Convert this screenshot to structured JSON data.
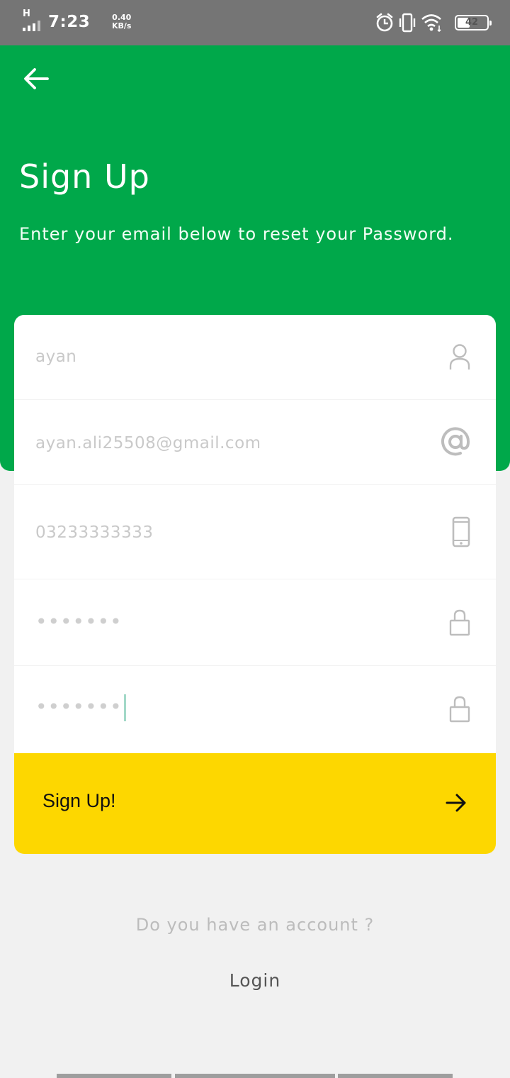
{
  "status_bar": {
    "network_type": "H",
    "time": "7:23",
    "speed_value": "0.40",
    "speed_unit": "KB/s",
    "battery_level": "42",
    "battery_fraction": 0.42,
    "icons": [
      "signal-icon",
      "alarm-icon",
      "vibrate-icon",
      "wifi-icon",
      "battery-icon"
    ]
  },
  "header": {
    "back_icon": "arrow-left-icon",
    "title": "Sign Up",
    "subtitle": "Enter your email below to reset your Password.",
    "color": "#00a84a"
  },
  "form": {
    "fields": [
      {
        "name": "name",
        "value": "ayan",
        "icon": "user-icon"
      },
      {
        "name": "email",
        "value": "ayan.ali25508@gmail.com",
        "icon": "at-icon"
      },
      {
        "name": "phone",
        "value": "03233333333",
        "icon": "phone-icon"
      },
      {
        "name": "password",
        "value": "•••••••",
        "icon": "lock-icon"
      },
      {
        "name": "confirm_password",
        "value": "•••••••",
        "icon": "lock-icon",
        "focused": true
      }
    ],
    "submit_label": "Sign Up!",
    "submit_icon": "arrow-right-icon",
    "submit_color": "#fdd700"
  },
  "footer": {
    "question": "Do you have an account ?",
    "login_label": "Login"
  }
}
